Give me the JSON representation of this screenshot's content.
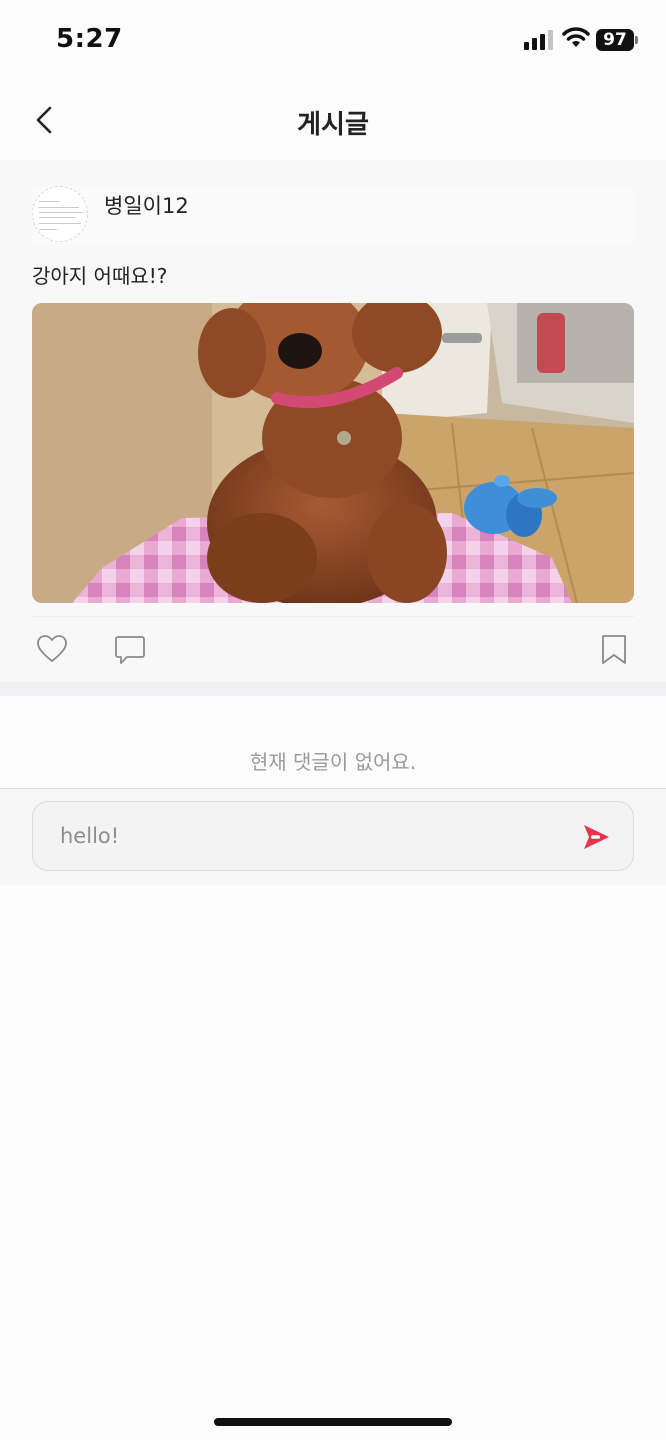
{
  "status_bar": {
    "time": "5:27",
    "battery": "97"
  },
  "header": {
    "title": "게시글"
  },
  "post": {
    "author": "병일이12",
    "text": "강아지 어때요!?",
    "image_alt": "강아지"
  },
  "comments": {
    "empty_message": "현재 댓글이 없어요."
  },
  "comment_input": {
    "value": "hello!"
  },
  "colors": {
    "accent": "#e8334a",
    "background": "#fcfcfd"
  }
}
